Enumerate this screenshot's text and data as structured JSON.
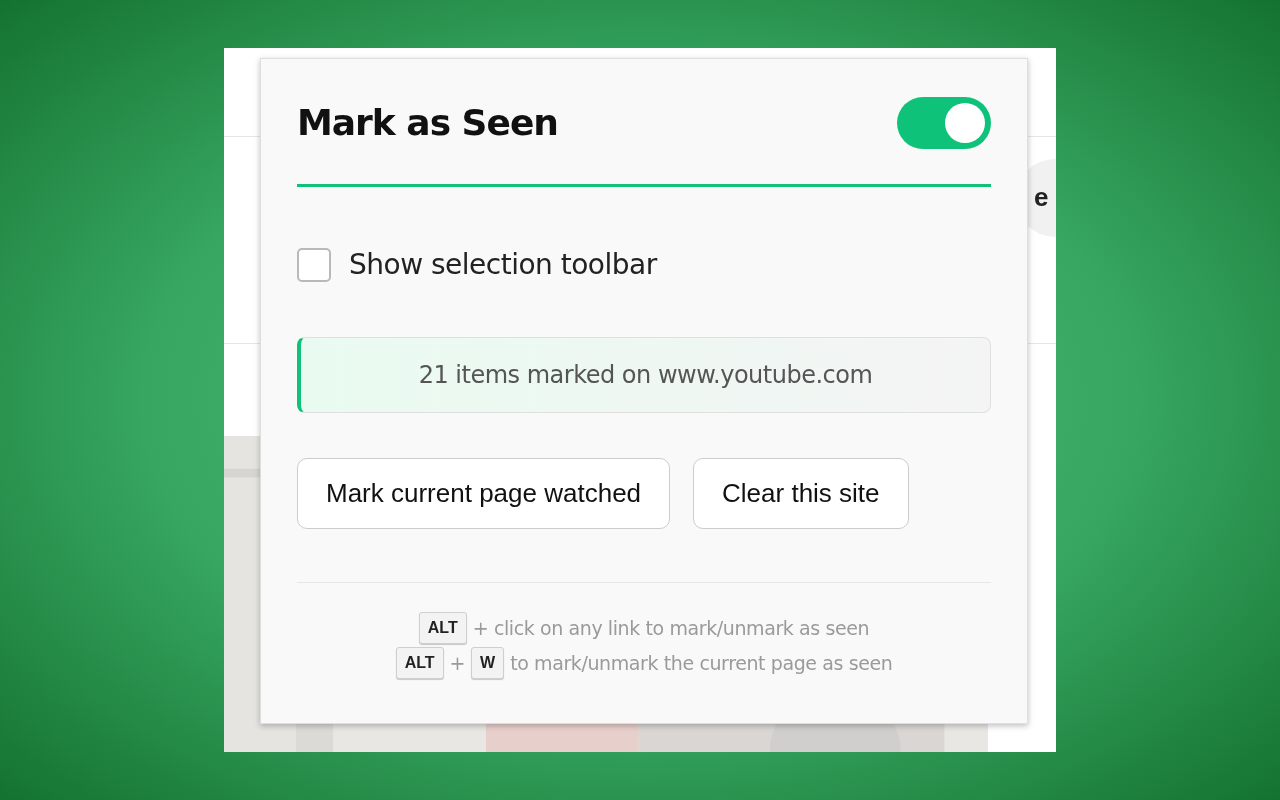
{
  "background_page": {
    "button_fragment": "e"
  },
  "popup": {
    "title": "Mark as Seen",
    "enabled": {
      "on": true
    },
    "options": [
      {
        "kind": "checkbox",
        "label": "Show selection toolbar",
        "checked": false
      }
    ],
    "status": "21 items marked on www.youtube.com",
    "buttons": [
      "Mark current page watched",
      "Clear this site"
    ],
    "hints": [
      {
        "parts": [
          {
            "kind": "key",
            "text": "ALT"
          },
          {
            "kind": "text",
            "text": "+ click on any link to mark/unmark as seen"
          }
        ]
      },
      {
        "parts": [
          {
            "kind": "key",
            "text": "ALT"
          },
          {
            "kind": "text",
            "text": "+"
          },
          {
            "kind": "key",
            "text": "W"
          },
          {
            "kind": "text",
            "text": "to mark/unmark the current page as seen"
          }
        ]
      }
    ]
  }
}
